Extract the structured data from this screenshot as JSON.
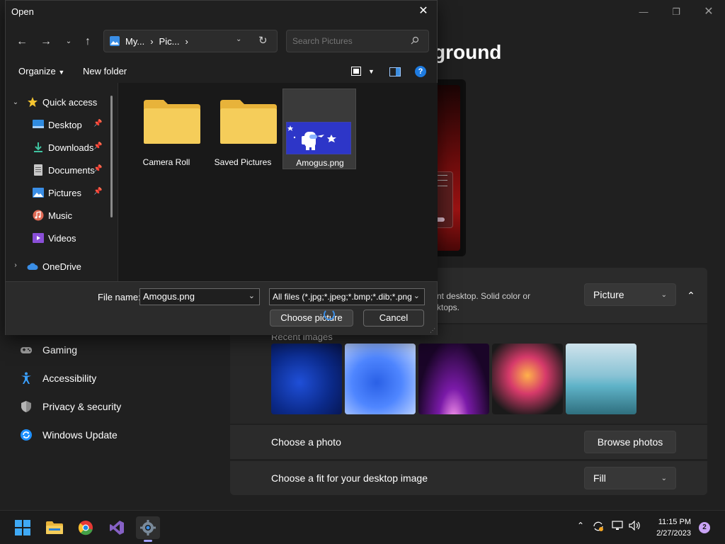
{
  "settings": {
    "page_title": "ground",
    "background_desc_line1": "nt desktop. Solid color or",
    "background_desc_line2": "ktops.",
    "background_type": "Picture",
    "recent_images_label": "Recent images",
    "choose_photo_label": "Choose a photo",
    "browse_photos": "Browse photos",
    "choose_fit_label": "Choose a fit for your desktop image",
    "fit_value": "Fill",
    "nav": [
      {
        "label": "Gaming",
        "icon": "gamepad-icon"
      },
      {
        "label": "Accessibility",
        "icon": "accessibility-icon"
      },
      {
        "label": "Privacy & security",
        "icon": "shield-icon"
      },
      {
        "label": "Windows Update",
        "icon": "update-icon"
      }
    ],
    "recent_image_colors": [
      "#1f4fd8",
      "#2a60e6",
      "#7a1aa8",
      "#d63a6a",
      "#5fb3c8"
    ]
  },
  "dialog": {
    "title": "Open",
    "address": {
      "seg1": "My...",
      "seg2": "Pic...",
      "sep": "›"
    },
    "search_placeholder": "Search Pictures",
    "organize": "Organize",
    "new_folder": "New folder",
    "nav_pane": [
      {
        "label": "Quick access",
        "icon": "star-icon",
        "pinned": false
      },
      {
        "label": "Desktop",
        "icon": "desktop-icon",
        "pinned": true
      },
      {
        "label": "Downloads",
        "icon": "download-icon",
        "pinned": true
      },
      {
        "label": "Documents",
        "icon": "documents-icon",
        "pinned": true
      },
      {
        "label": "Pictures",
        "icon": "pictures-icon",
        "pinned": true
      },
      {
        "label": "Music",
        "icon": "music-icon",
        "pinned": false
      },
      {
        "label": "Videos",
        "icon": "videos-icon",
        "pinned": false
      },
      {
        "label": "OneDrive",
        "icon": "cloud-icon",
        "pinned": false
      }
    ],
    "files": [
      {
        "name": "Camera Roll",
        "type": "folder"
      },
      {
        "name": "Saved Pictures",
        "type": "folder"
      },
      {
        "name": "Amogus.png",
        "type": "image",
        "selected": true
      }
    ],
    "file_name_label": "File name:",
    "file_name_value": "Amogus.png",
    "file_type_filter": "All files (*.jpg;*.jpeg;*.bmp;*.dib;*.png",
    "choose_button": "Choose picture",
    "cancel_button": "Cancel"
  },
  "taskbar": {
    "time": "11:15 PM",
    "date": "2/27/2023",
    "notification_count": "2"
  }
}
